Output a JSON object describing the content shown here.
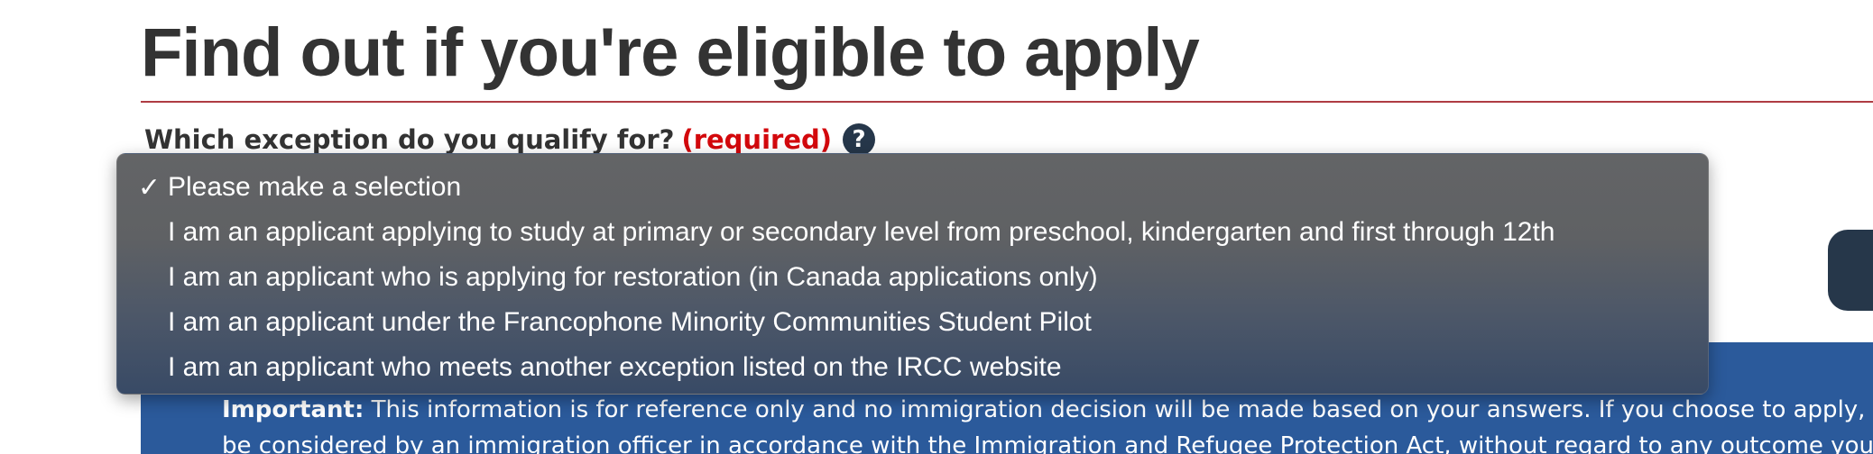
{
  "page": {
    "title": "Find out if you're eligible to apply"
  },
  "question": {
    "label": "Which exception do you qualify for?",
    "required": "(required)",
    "help_icon_glyph": "?"
  },
  "dropdown": {
    "check_glyph": "✓",
    "options": [
      {
        "label": "Please make a selection",
        "selected": true
      },
      {
        "label": "I am an applicant applying to study at primary or secondary level from preschool, kindergarten and first through 12th",
        "selected": false
      },
      {
        "label": "I am an applicant who is applying for restoration (in Canada applications only)",
        "selected": false
      },
      {
        "label": "I am an applicant under the Francophone Minority Communities Student Pilot",
        "selected": false
      },
      {
        "label": "I am an applicant who meets another exception listed on the IRCC website",
        "selected": false
      }
    ]
  },
  "notice": {
    "label": "Important:",
    "line1": "This information is for reference only and no immigration decision will be made based on your answers. If you choose to apply, your application will",
    "line2": "be considered by an immigration officer in accordance with the Immigration and Refugee Protection Act, without regard to any outcome you"
  },
  "colors": {
    "title_text": "#333333",
    "title_rule": "#af3c43",
    "required": "#d3080c",
    "help_icon_bg": "#26374a",
    "notice_bg": "#2b5a9b",
    "dropdown_bg_top": "#636466",
    "dropdown_bg_bottom": "#384a66"
  }
}
